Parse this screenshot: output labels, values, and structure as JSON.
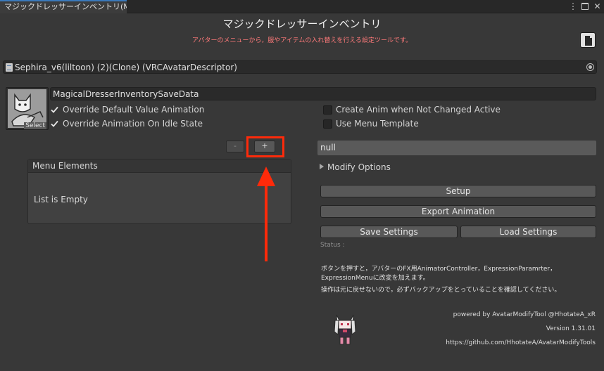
{
  "window": {
    "tab_title": "マジックドレッサーインベントリ(M...",
    "menu_glyph": "⋮",
    "close_glyph": "✕"
  },
  "header": {
    "title": "マジックドレッサーインベントリ",
    "subtitle": "アバターのメニューから，服やアイテムの入れ替えを行える設定ツールです。"
  },
  "descriptor_field": {
    "value": "Sephira_v6(liltoon) (2)(Clone) (VRCAvatarDescriptor)"
  },
  "save_data": {
    "name": "MagicalDresserInventorySaveData",
    "thumbnail_label": "Select"
  },
  "options": [
    {
      "label": "Override Default Value Animation",
      "checked": true
    },
    {
      "label": "Override Animation On Idle State",
      "checked": true
    },
    {
      "label": "Create Anim when Not Changed Active",
      "checked": false
    },
    {
      "label": "Use Menu Template",
      "checked": false
    }
  ],
  "menu_list": {
    "minus_label": "-",
    "plus_label": "+",
    "header": "Menu Elements",
    "empty_text": "List is Empty"
  },
  "right_panel": {
    "selected_field": "null",
    "foldout_label": "Modify Options",
    "setup_label": "Setup",
    "export_label": "Export Animation",
    "save_settings_label": "Save Settings",
    "load_settings_label": "Load Settings",
    "status_label": "Status :",
    "info_line1": "ボタンを押すと，アバターのFX用AnimatorController，ExpressionParamrter，ExpressionMenuに改変を加えます。",
    "info_line2": "操作は元に戻せないので，必ずバックアップをとっていることを確認してください。",
    "credit_powered": "powered by AvatarModifyTool @HhotateA_xR",
    "credit_version": "Version 1.31.01",
    "credit_url": "https://github.com/HhotateA/AvatarModifyTools"
  },
  "colors": {
    "background": "#383838",
    "subtitle_red": "#ff7a7a",
    "highlight_red": "#ff2a0a",
    "tab_accent": "#3a79bb"
  }
}
